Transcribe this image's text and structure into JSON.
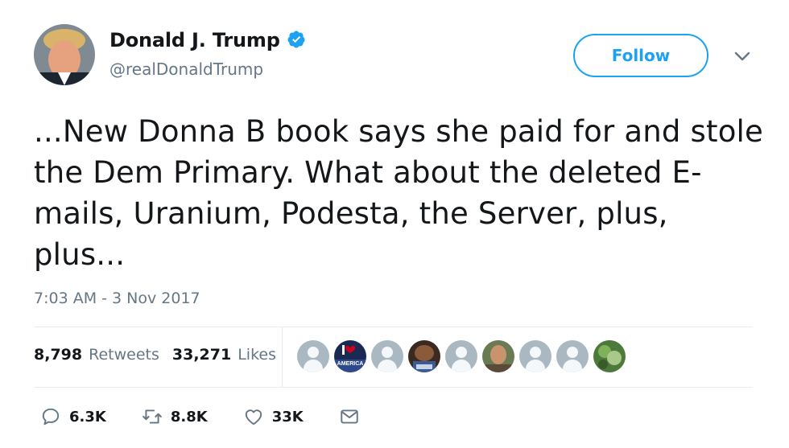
{
  "user": {
    "display_name": "Donald J. Trump",
    "handle": "@realDonaldTrump",
    "verified": true
  },
  "follow_button": {
    "label": "Follow"
  },
  "tweet": {
    "text": "...New Donna B book says she paid for and stole the Dem Primary. What about the deleted E-mails, Uranium, Podesta, the Server, plus, plus...",
    "timestamp": "7:03 AM - 3 Nov 2017"
  },
  "stats": {
    "retweets_count": "8,798",
    "retweets_label": "Retweets",
    "likes_count": "33,271",
    "likes_label": "Likes"
  },
  "likers": [
    {
      "type": "default"
    },
    {
      "type": "image",
      "badge": "AMERICA"
    },
    {
      "type": "default"
    },
    {
      "type": "image"
    },
    {
      "type": "default"
    },
    {
      "type": "image"
    },
    {
      "type": "default"
    },
    {
      "type": "default"
    },
    {
      "type": "image"
    }
  ],
  "actions": {
    "reply_count": "6.3K",
    "retweet_count": "8.8K",
    "like_count": "33K"
  },
  "icons": {
    "reply": "reply-icon",
    "retweet": "retweet-icon",
    "like": "heart-icon",
    "dm": "envelope-icon",
    "verified": "verified-badge-icon",
    "caret": "chevron-down-icon"
  },
  "colors": {
    "accent": "#1da1f2",
    "secondary_text": "#657786",
    "divider": "#e6ecf0"
  }
}
